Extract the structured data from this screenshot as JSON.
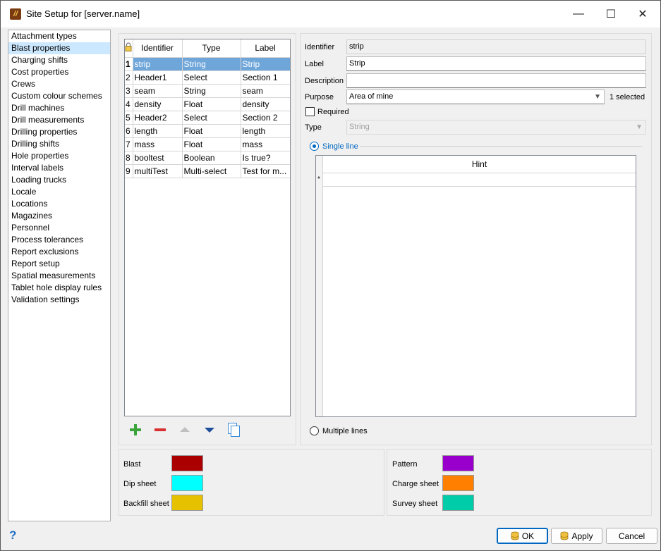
{
  "window": {
    "title": "Site Setup for [server.name]",
    "controls": {
      "minimize": "—",
      "maximize": "☐",
      "close": "✕"
    }
  },
  "nav": {
    "items": [
      "Attachment types",
      "Blast properties",
      "Charging shifts",
      "Cost properties",
      "Crews",
      "Custom colour schemes",
      "Drill machines",
      "Drill measurements",
      "Drilling properties",
      "Drilling shifts",
      "Hole properties",
      "Interval labels",
      "Loading trucks",
      "Locale",
      "Locations",
      "Magazines",
      "Personnel",
      "Process tolerances",
      "Report exclusions",
      "Report setup",
      "Spatial measurements",
      "Tablet hole display rules",
      "Validation settings"
    ],
    "selected_index": 1
  },
  "grid": {
    "columns": [
      "Identifier",
      "Type",
      "Label"
    ],
    "rows": [
      {
        "n": "1",
        "identifier": "strip",
        "type": "String",
        "label": "Strip"
      },
      {
        "n": "2",
        "identifier": "Header1",
        "type": "Select",
        "label": "Section 1"
      },
      {
        "n": "3",
        "identifier": "seam",
        "type": "String",
        "label": "seam"
      },
      {
        "n": "4",
        "identifier": "density",
        "type": "Float",
        "label": "density"
      },
      {
        "n": "5",
        "identifier": "Header2",
        "type": "Select",
        "label": "Section 2"
      },
      {
        "n": "6",
        "identifier": "length",
        "type": "Float",
        "label": "length"
      },
      {
        "n": "7",
        "identifier": "mass",
        "type": "Float",
        "label": "mass"
      },
      {
        "n": "8",
        "identifier": "booltest",
        "type": "Boolean",
        "label": "Is true?"
      },
      {
        "n": "9",
        "identifier": "multiTest",
        "type": "Multi-select",
        "label": "Test for m..."
      }
    ],
    "selected_index": 0
  },
  "toolbar": {
    "add_icon": "plus-icon",
    "remove_icon": "minus-icon",
    "up_icon": "triangle-up-icon",
    "down_icon": "triangle-down-icon",
    "copy_icon": "copy-icon"
  },
  "form": {
    "identifier_label": "Identifier",
    "identifier_value": "strip",
    "label_label": "Label",
    "label_value": "Strip",
    "description_label": "Description",
    "description_value": "",
    "purpose_label": "Purpose",
    "purpose_value": "Area of mine",
    "purpose_count": "1 selected",
    "required_label": "Required",
    "type_label": "Type",
    "type_value": "String",
    "single_line_label": "Single line",
    "multiple_lines_label": "Multiple lines",
    "hint_header": "Hint",
    "hint_new_row_marker": "*"
  },
  "colors": {
    "left": [
      {
        "label": "Blast",
        "color": "#aa0000"
      },
      {
        "label": "Dip sheet",
        "color": "#00ffff"
      },
      {
        "label": "Backfill sheet",
        "color": "#e5c100"
      }
    ],
    "right": [
      {
        "label": "Pattern",
        "color": "#9900cc"
      },
      {
        "label": "Charge sheet",
        "color": "#ff7f00"
      },
      {
        "label": "Survey sheet",
        "color": "#00ccaa"
      }
    ]
  },
  "buttons": {
    "help": "?",
    "ok": "OK",
    "apply": "Apply",
    "cancel": "Cancel"
  }
}
